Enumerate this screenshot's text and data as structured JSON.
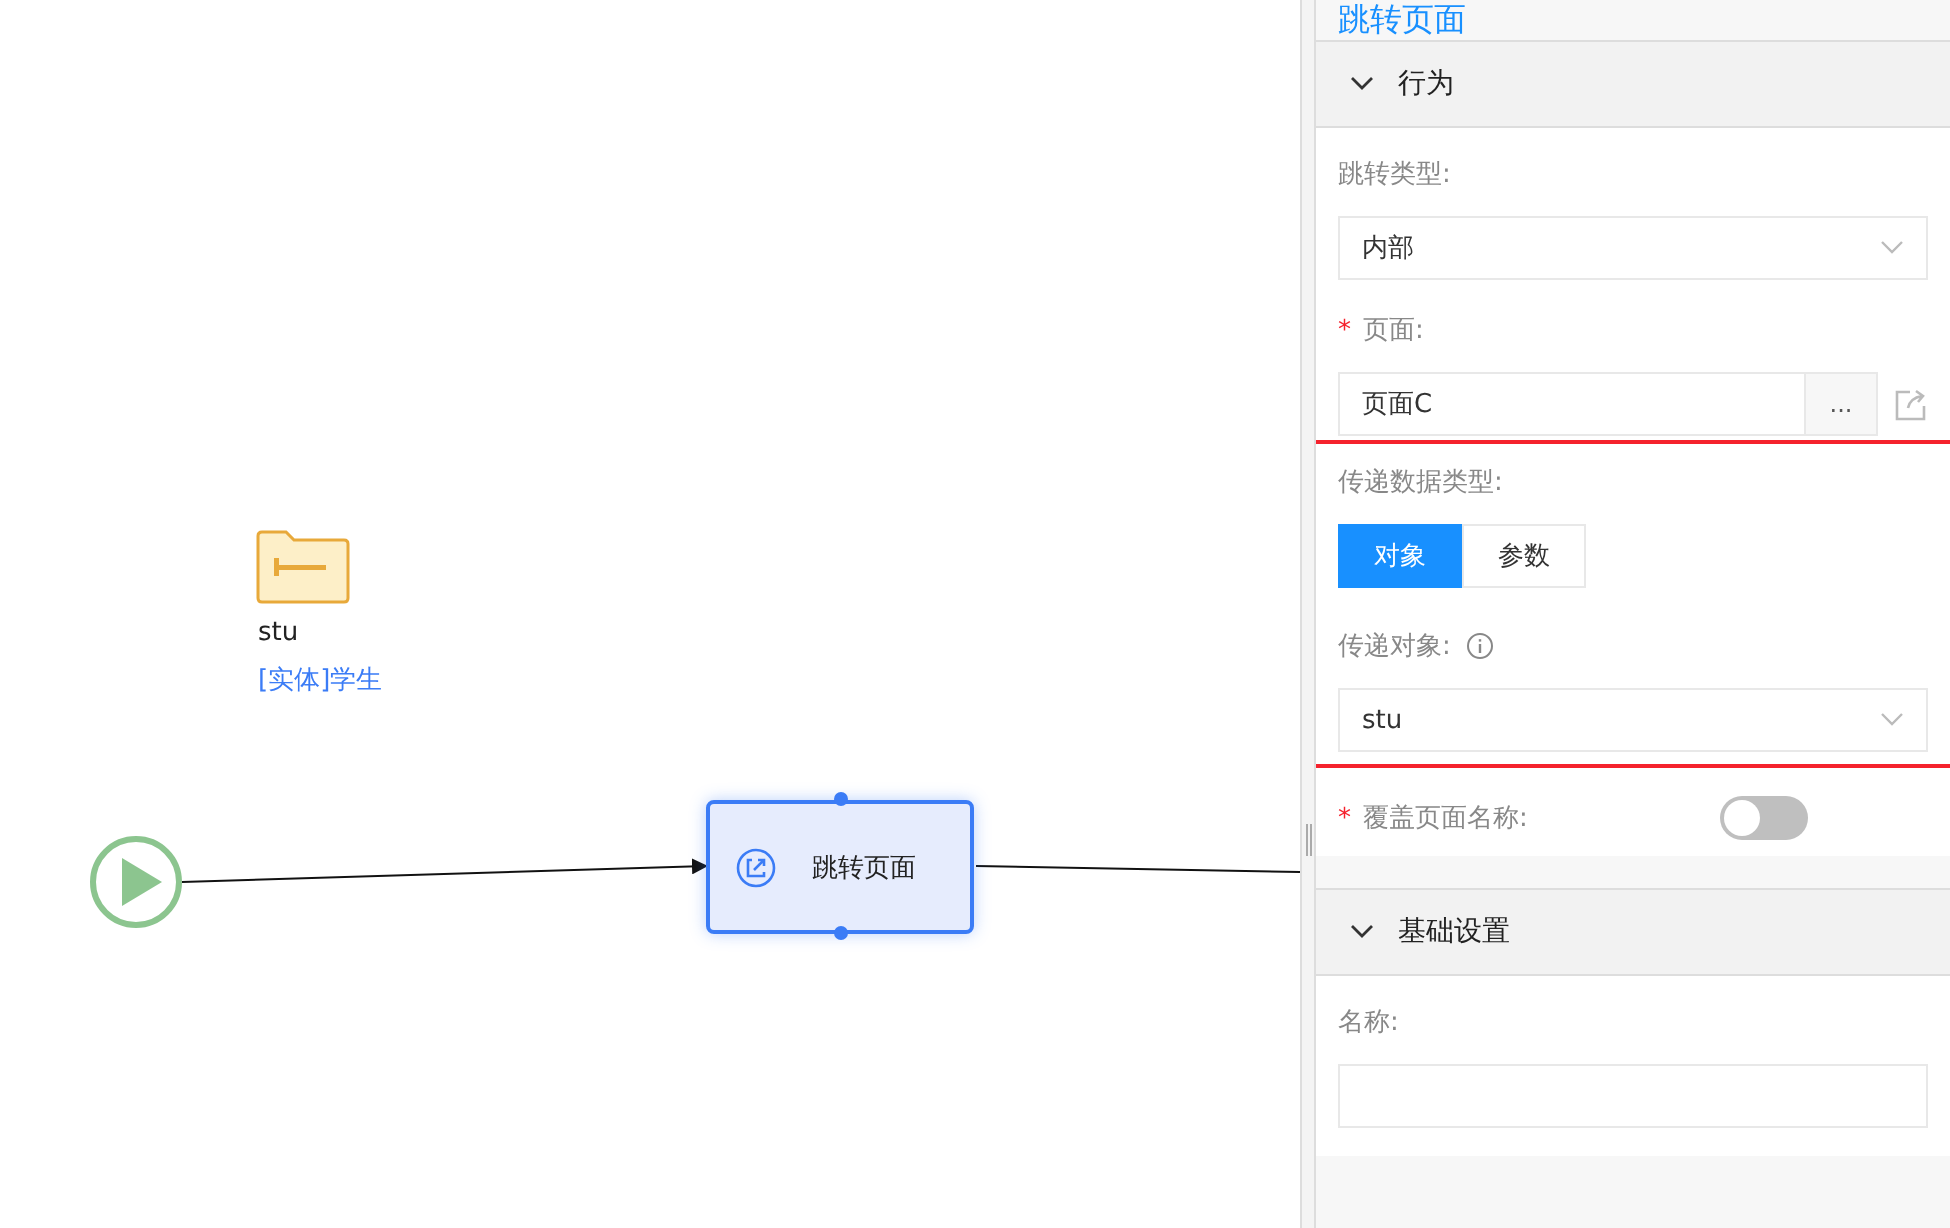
{
  "canvas": {
    "entity": {
      "name": "stu",
      "type": "[实体]学生"
    },
    "node": {
      "label": "跳转页面",
      "selected": true
    }
  },
  "panel": {
    "title": "跳转页面",
    "sections": [
      {
        "title": "行为",
        "expanded": true,
        "items": [
          {
            "kind": "select",
            "label": "跳转类型:",
            "value": "内部"
          },
          {
            "kind": "picker",
            "marker": "*",
            "label": "页面:",
            "value": "页面C",
            "button": "..."
          },
          {
            "kind": "group",
            "highlighted": true,
            "items": [
              {
                "kind": "segmented",
                "label": "传递数据类型:",
                "options": [
                  {
                    "label": "对象",
                    "selected": true
                  },
                  {
                    "label": "参数",
                    "selected": false
                  }
                ]
              },
              {
                "kind": "select",
                "label": "传递对象:",
                "info": true,
                "value": "stu"
              }
            ]
          },
          {
            "kind": "switch",
            "marker": "*",
            "label": "覆盖页面名称:",
            "on": false
          }
        ]
      },
      {
        "title": "基础设置",
        "expanded": true,
        "items": [
          {
            "kind": "text",
            "label": "名称:"
          }
        ]
      }
    ]
  }
}
